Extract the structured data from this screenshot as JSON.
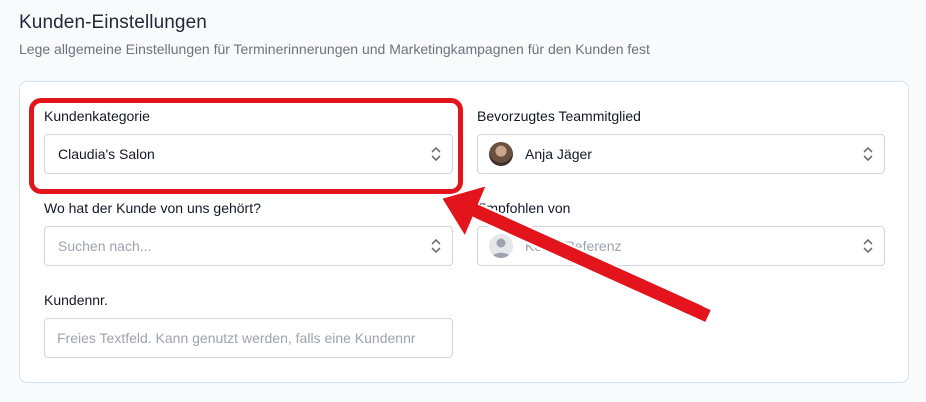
{
  "header": {
    "title": "Kunden-Einstellungen",
    "description": "Lege allgemeine Einstellungen für Terminerinnerungen und Marketingkampagnen für den Kunden fest"
  },
  "fields": {
    "category": {
      "label": "Kundenkategorie",
      "value": "Claudia's Salon",
      "icon": "chevron-updown-icon"
    },
    "team_member": {
      "label": "Bevorzugtes Teammitglied",
      "value": "Anja Jäger",
      "avatar": "user-photo"
    },
    "source": {
      "label": "Wo hat der Kunde von uns gehört?",
      "placeholder": "Suchen nach..."
    },
    "referred_by": {
      "label": "Empfohlen von",
      "placeholder": "Keine Referenz",
      "avatar": "user-placeholder-icon"
    },
    "customer_number": {
      "label": "Kundennr.",
      "placeholder": "Freies Textfeld. Kann genutzt werden, falls eine Kundennr"
    }
  },
  "annotation": {
    "highlight_color": "#e3141b",
    "target": "Kundenkategorie"
  }
}
